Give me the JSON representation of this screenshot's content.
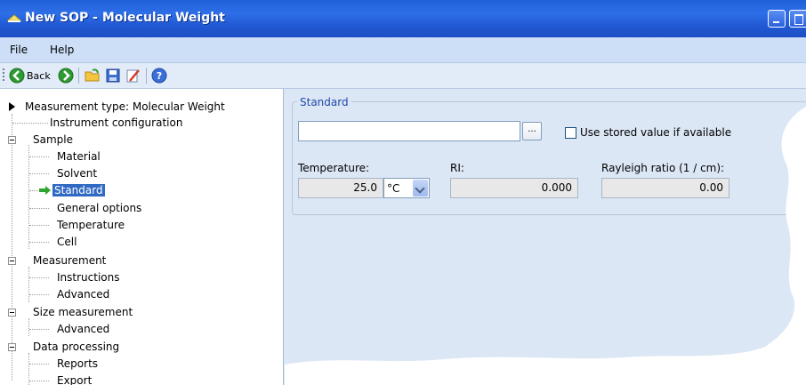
{
  "window": {
    "title": "New SOP - Molecular Weight"
  },
  "menu": {
    "items": [
      "File",
      "Help"
    ]
  },
  "toolbar": {
    "back_label": "Back",
    "icons": [
      "back-icon",
      "forward-icon",
      "open-folder-icon",
      "save-icon",
      "edit-icon",
      "help-icon"
    ]
  },
  "tree": {
    "root": "Measurement type: Molecular Weight",
    "items": {
      "instrument_configuration": "Instrument configuration",
      "sample": "Sample",
      "material": "Material",
      "solvent": "Solvent",
      "standard": "Standard",
      "general_options": "General options",
      "temperature": "Temperature",
      "cell": "Cell",
      "measurement": "Measurement",
      "instructions": "Instructions",
      "advanced_1": "Advanced",
      "size_measurement": "Size measurement",
      "advanced_2": "Advanced",
      "data_processing": "Data processing",
      "reports": "Reports",
      "export": "Export"
    },
    "selected": "Standard"
  },
  "standard_panel": {
    "group_title": "Standard",
    "standard_input_value": "",
    "browse_label": "...",
    "use_stored_label": "Use stored value if available",
    "use_stored_checked": false,
    "temperature_label": "Temperature:",
    "temperature_value": "25.0",
    "temperature_unit": "°C",
    "ri_label": "RI:",
    "ri_value": "0.000",
    "rayleigh_label": "Rayleigh ratio (1 / cm):",
    "rayleigh_value": "0.00"
  },
  "colors": {
    "titlebar": "#2563df",
    "menubar": "#ccdff7",
    "panel": "#dce7f6",
    "selection": "#316ac5",
    "group_title": "#1f4aa8"
  }
}
